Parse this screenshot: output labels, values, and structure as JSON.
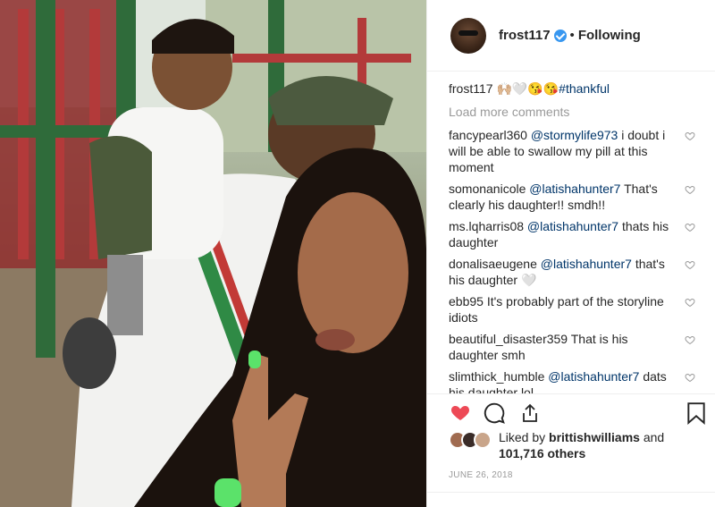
{
  "post": {
    "author": "frost117",
    "follow_status": "Following",
    "separator": "•"
  },
  "caption": {
    "author": "frost117",
    "text": "🙌🏼🤍😘😘",
    "hashtag": "#thankful"
  },
  "load_more_label": "Load more comments",
  "comments": [
    {
      "user": "fancypearl360",
      "mention": "@stormylife973",
      "text": " i doubt i will be able to swallow my pill at this moment"
    },
    {
      "user": "somonanicole",
      "mention": "@latishahunter7",
      "text": " That's clearly his daughter!! smdh!!"
    },
    {
      "user": "ms.lqharris08",
      "mention": "@latishahunter7",
      "text": " thats his daughter"
    },
    {
      "user": "donalisaeugene",
      "mention": "@latishahunter7",
      "text": " that's his daughter 🤍"
    },
    {
      "user": "ebb95",
      "mention": "",
      "text": " It's probably part of the storyline idiots"
    },
    {
      "user": "beautiful_disaster359",
      "mention": "",
      "text": " That is his daughter smh"
    },
    {
      "user": "slimthick_humble",
      "mention": "@latishahunter7",
      "text": " dats his daughter lol"
    }
  ],
  "likes": {
    "prefix": "Liked by ",
    "first_liker": "brittishwilliams",
    "conjunction": " and",
    "count_text": "101,716 others"
  },
  "date": "JUNE 26, 2018",
  "icons": {
    "like": "heart-filled-icon",
    "comment": "comment-bubble-icon",
    "share": "share-icon",
    "save": "bookmark-icon",
    "comment_like": "heart-outline-icon",
    "verified": "verified-badge-icon"
  },
  "colors": {
    "like_red": "#ed4956",
    "verified_blue": "#3897f0",
    "link_blue": "#003569",
    "muted_gray": "#999999"
  }
}
